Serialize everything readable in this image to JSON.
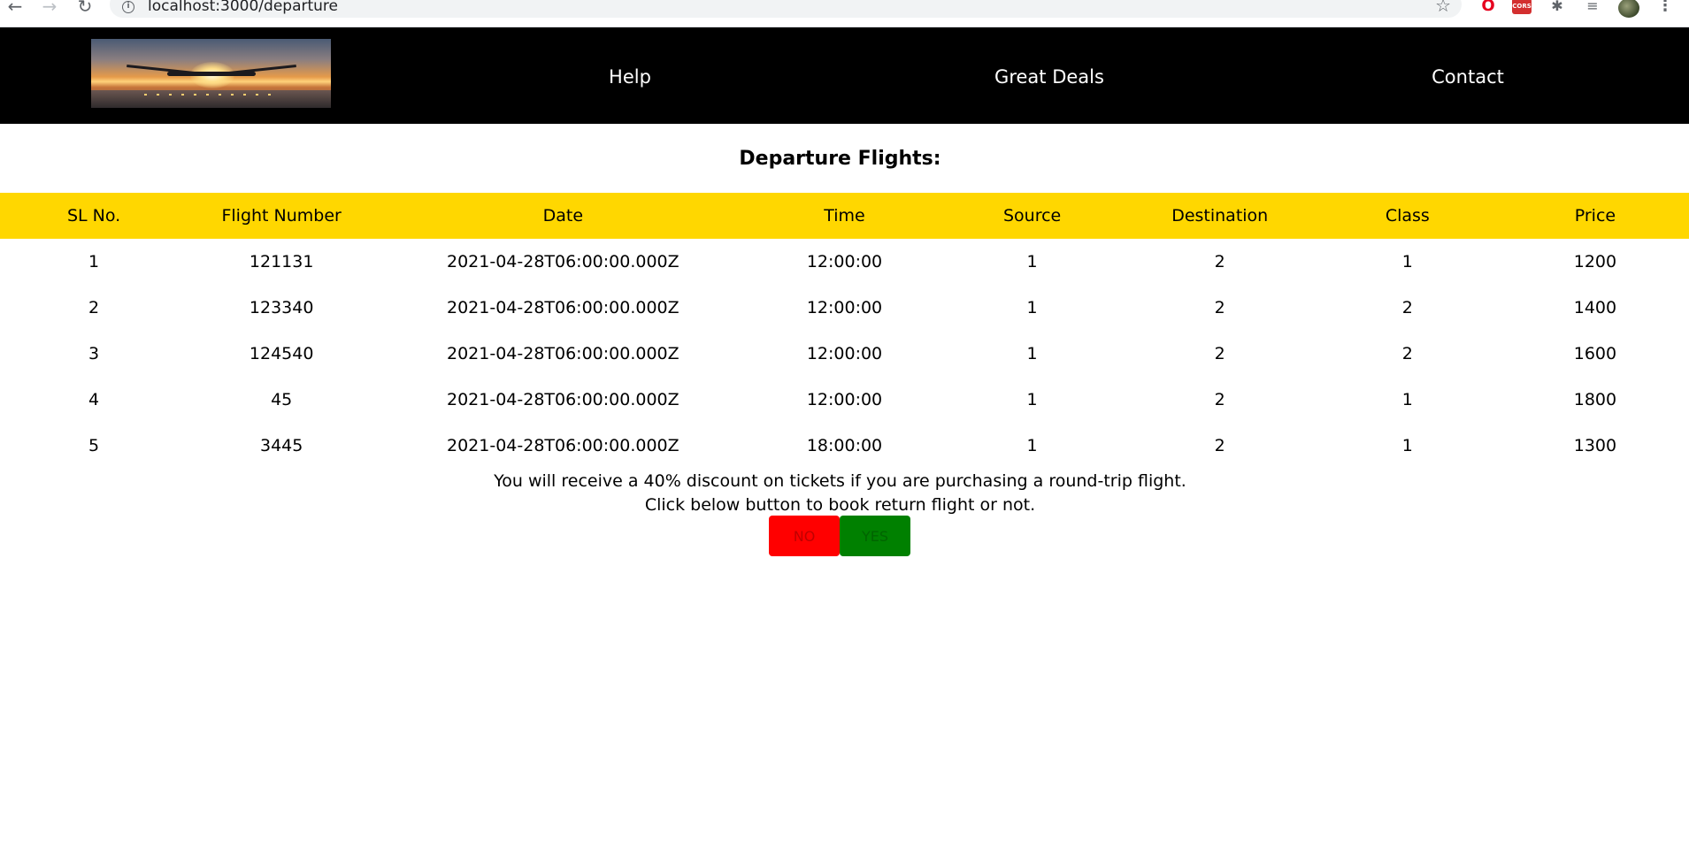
{
  "browser": {
    "url": "localhost:3000/departure",
    "back_icon": "←",
    "forward_icon": "→",
    "reload_icon": "↻",
    "info_icon": "i",
    "star_icon": "☆",
    "ext_opera_icon": "O",
    "ext_cors_label": "CORS",
    "ext_puzzle_icon": "✱",
    "ext_queue_icon": "≡",
    "menu_icon": "⋮"
  },
  "header": {
    "nav": [
      {
        "label": "Help"
      },
      {
        "label": "Great Deals"
      },
      {
        "label": "Contact"
      }
    ]
  },
  "main": {
    "title": "Departure Flights:",
    "table": {
      "columns": [
        "SL No.",
        "Flight Number",
        "Date",
        "Time",
        "Source",
        "Destination",
        "Class",
        "Price"
      ],
      "rows": [
        [
          "1",
          "121131",
          "2021-04-28T06:00:00.000Z",
          "12:00:00",
          "1",
          "2",
          "1",
          "1200"
        ],
        [
          "2",
          "123340",
          "2021-04-28T06:00:00.000Z",
          "12:00:00",
          "1",
          "2",
          "2",
          "1400"
        ],
        [
          "3",
          "124540",
          "2021-04-28T06:00:00.000Z",
          "12:00:00",
          "1",
          "2",
          "2",
          "1600"
        ],
        [
          "4",
          "45",
          "2021-04-28T06:00:00.000Z",
          "12:00:00",
          "1",
          "2",
          "1",
          "1800"
        ],
        [
          "5",
          "3445",
          "2021-04-28T06:00:00.000Z",
          "18:00:00",
          "1",
          "2",
          "1",
          "1300"
        ]
      ]
    },
    "notice_line1": "You will receive a 40% discount on tickets if you are purchasing a round-trip flight.",
    "notice_line2": "Click below button to book return flight or not.",
    "buttons": {
      "no": "NO",
      "yes": "YES"
    }
  },
  "colors": {
    "header_bg": "#000000",
    "table_header_bg": "#ffd700",
    "no_button": "#ff0000",
    "yes_button": "#008000"
  }
}
